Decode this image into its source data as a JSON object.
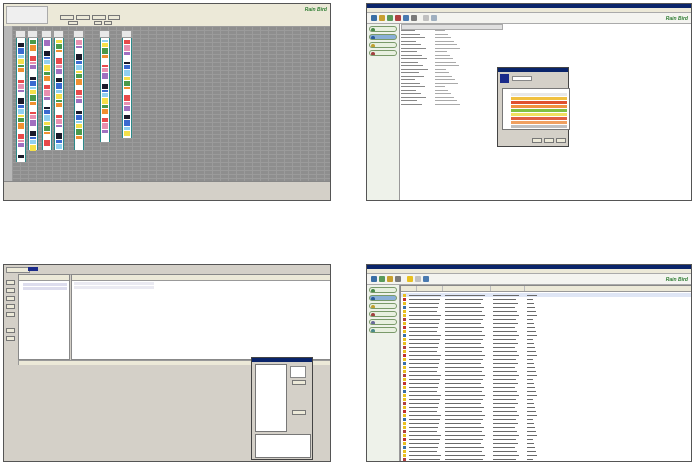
{
  "logo": {
    "text": "Rain Bird"
  },
  "colors": {
    "window_bg": "#d4d0c8",
    "grid_bg": "#8e8e8e",
    "teal_border": "#2b8a8a",
    "titlebar": "#0a246a",
    "brand_green": "#2f7d32"
  },
  "screens": [
    {
      "name": "station-schedule-grid"
    },
    {
      "name": "site-properties-with-dialog"
    },
    {
      "name": "station-list-with-dialog"
    },
    {
      "name": "event-log-list"
    }
  ],
  "icons": [
    "save-icon",
    "open-icon",
    "print-icon",
    "refresh-icon",
    "chart-icon",
    "help-icon",
    "calendar-icon",
    "controller-icon",
    "flow-icon",
    "alert-icon"
  ]
}
